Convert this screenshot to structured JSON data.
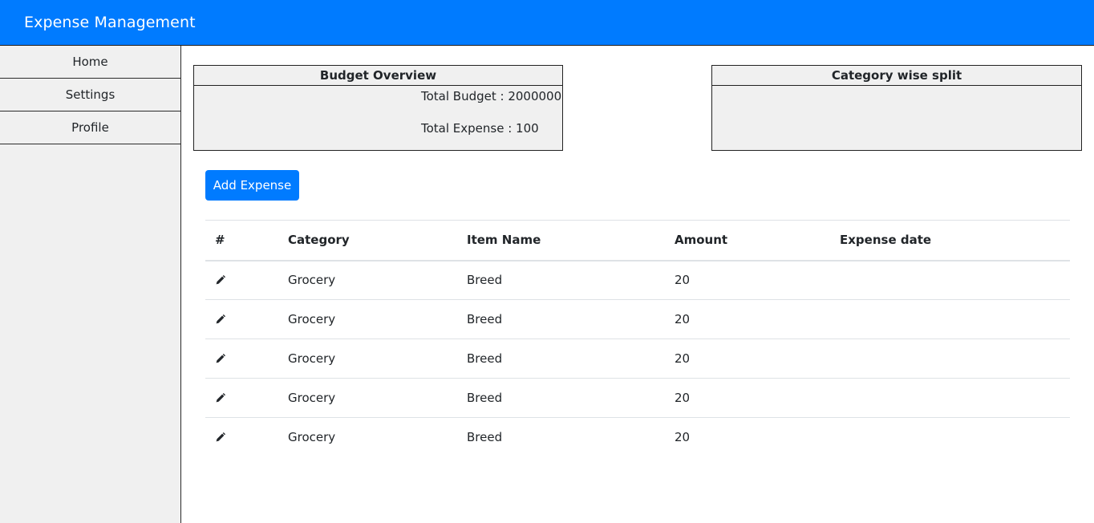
{
  "navbar": {
    "brand": "Expense Management"
  },
  "sidebar": {
    "items": [
      {
        "label": "Home"
      },
      {
        "label": "Settings"
      },
      {
        "label": "Profile"
      }
    ]
  },
  "budget_overview": {
    "title": "Budget Overview",
    "total_budget": "Total Budget : 2000000",
    "total_expense": "Total Expense : 100"
  },
  "category_split": {
    "title": "Category wise split"
  },
  "actions": {
    "add_expense_label": "Add Expense"
  },
  "table": {
    "headers": {
      "index": "#",
      "category": "Category",
      "item_name": "Item Name",
      "amount": "Amount",
      "expense_date": "Expense date"
    },
    "rows": [
      {
        "category": "Grocery",
        "item_name": "Breed",
        "amount": "20",
        "expense_date": "",
        "icon": "pencil-icon"
      },
      {
        "category": "Grocery",
        "item_name": "Breed",
        "amount": "20",
        "expense_date": "",
        "icon": "pencil-icon"
      },
      {
        "category": "Grocery",
        "item_name": "Breed",
        "amount": "20",
        "expense_date": "",
        "icon": "pencil-icon"
      },
      {
        "category": "Grocery",
        "item_name": "Breed",
        "amount": "20",
        "expense_date": "",
        "icon": "pencil-icon"
      },
      {
        "category": "Grocery",
        "item_name": "Breed",
        "amount": "20",
        "expense_date": "",
        "icon": "pencil-icon"
      }
    ]
  },
  "colors": {
    "primary": "#007bff",
    "sidebar_bg": "#f0f0f0",
    "card_bg": "#f0f0f0",
    "text": "#212529"
  }
}
